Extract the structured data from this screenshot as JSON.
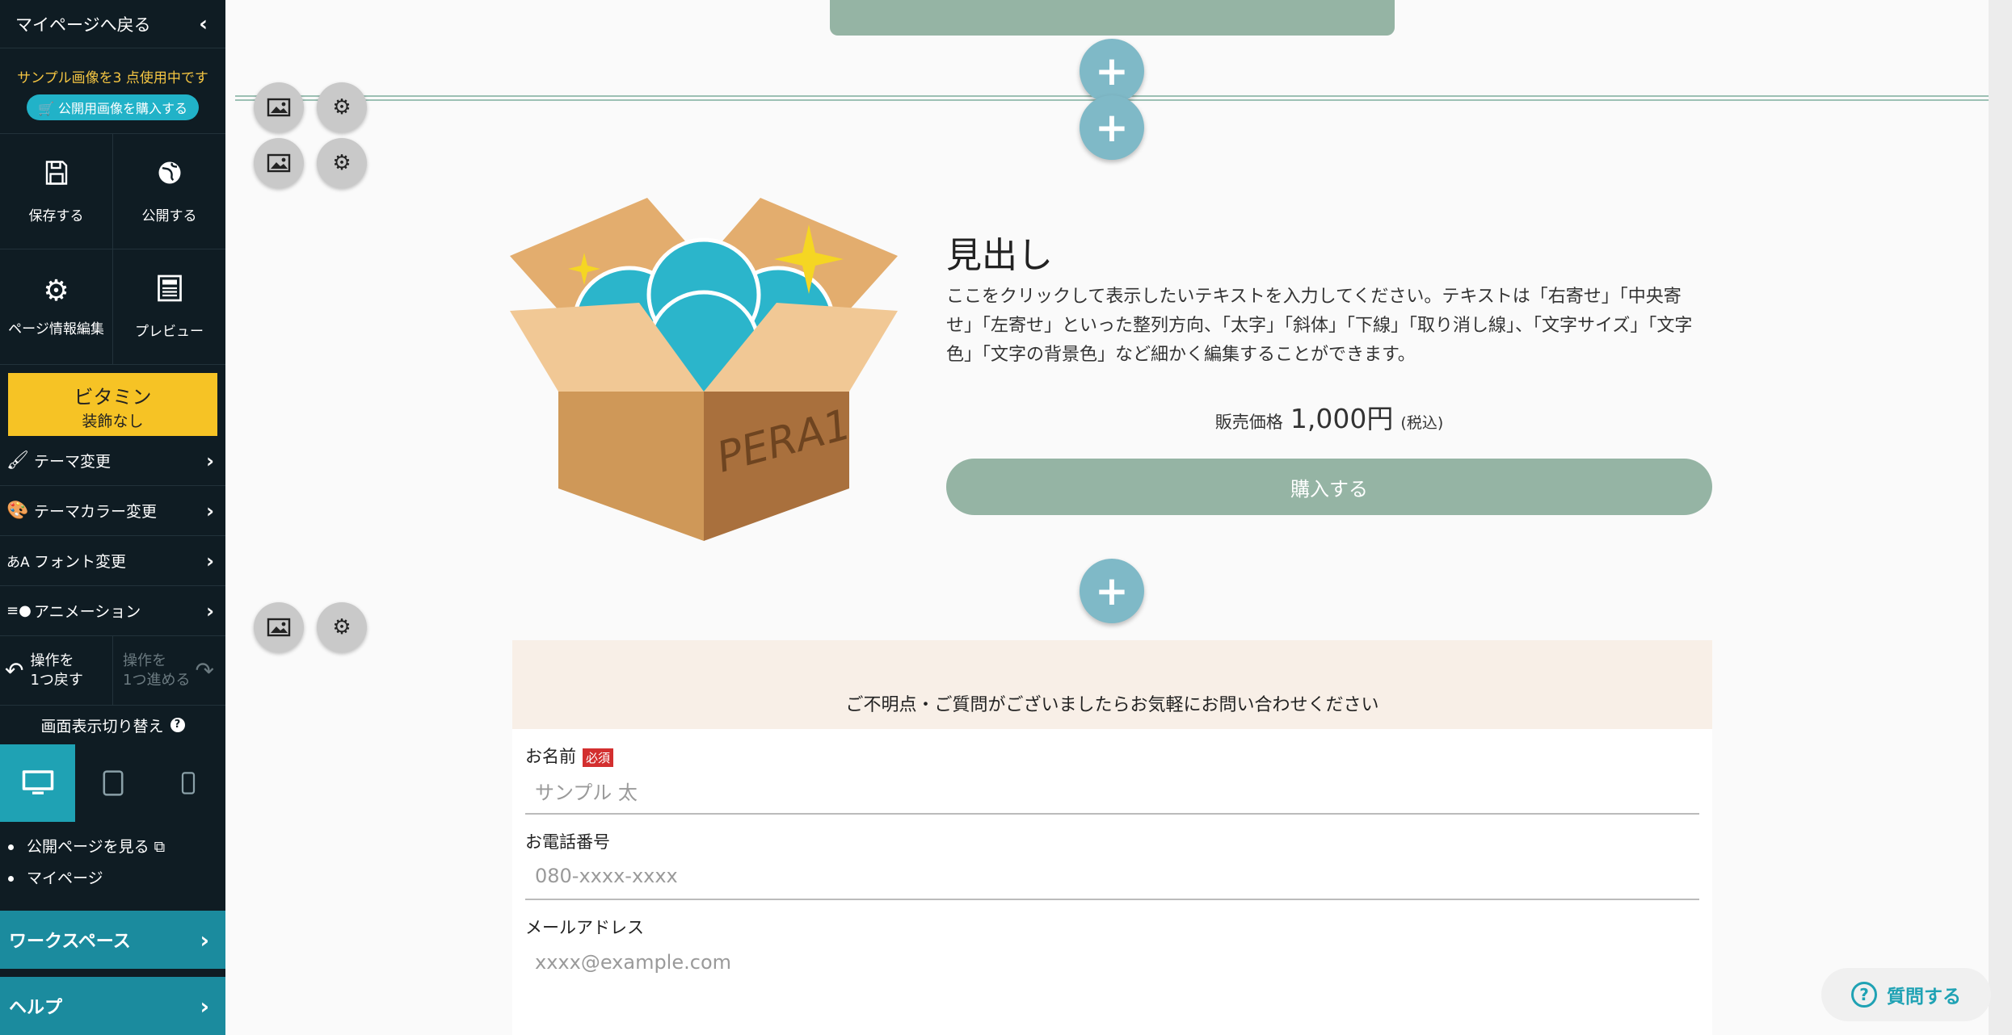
{
  "sidebar": {
    "back_label": "マイページへ戻る",
    "sample_notice": "サンプル画像を3 点使用中です",
    "buy_images_label": "公開用画像を購入する",
    "save_label": "保存する",
    "publish_label": "公開する",
    "page_info_label": "ページ情報編集",
    "preview_label": "プレビュー",
    "theme_name": "ビタミン",
    "theme_decor": "装飾なし",
    "menu": [
      {
        "label": "テーマ変更",
        "icon": "paint-roller-icon"
      },
      {
        "label": "テーマカラー変更",
        "icon": "palette-icon"
      },
      {
        "label": "フォント変更",
        "icon": "font-icon"
      },
      {
        "label": "アニメーション",
        "icon": "animation-icon"
      }
    ],
    "undo_line1": "操作を",
    "undo_line2": "1つ戻す",
    "redo_line1": "操作を",
    "redo_line2": "1つ進める",
    "view_switch_label": "画面表示切り替え",
    "links": [
      "公開ページを見る",
      "マイページ"
    ],
    "workspace_label": "ワークスペース",
    "help_label": "ヘルプ"
  },
  "content": {
    "heading": "見出し",
    "body_text": "ここをクリックして表示したいテキストを入力してください。テキストは「右寄せ」「中央寄せ」「左寄せ」といった整列方向、「太字」「斜体」「下線」「取り消し線」、「文字サイズ」「文字色」「文字の背景色」など細かく編集することができます。",
    "price_label": "販売価格",
    "price_value": "1,000円",
    "price_tax": "(税込)",
    "buy_label": "購入する",
    "box_label": "PERA1"
  },
  "form": {
    "header": "ご不明点・ご質問がございましたらお気軽にお問い合わせください",
    "name_label": "お名前",
    "required_badge": "必須",
    "name_placeholder": "サンプル 太",
    "phone_label": "お電話番号",
    "phone_placeholder": "080-xxxx-xxxx",
    "email_label": "メールアドレス",
    "email_placeholder": "xxxx@example.com"
  },
  "help_button_label": "質問する",
  "colors": {
    "sidebar_bg": "#0f1c23",
    "accent_teal": "#1fa2b4",
    "vitamin_yellow": "#f6c325",
    "sage_green": "#95b4a4",
    "plus_button": "#7fb9c7"
  }
}
